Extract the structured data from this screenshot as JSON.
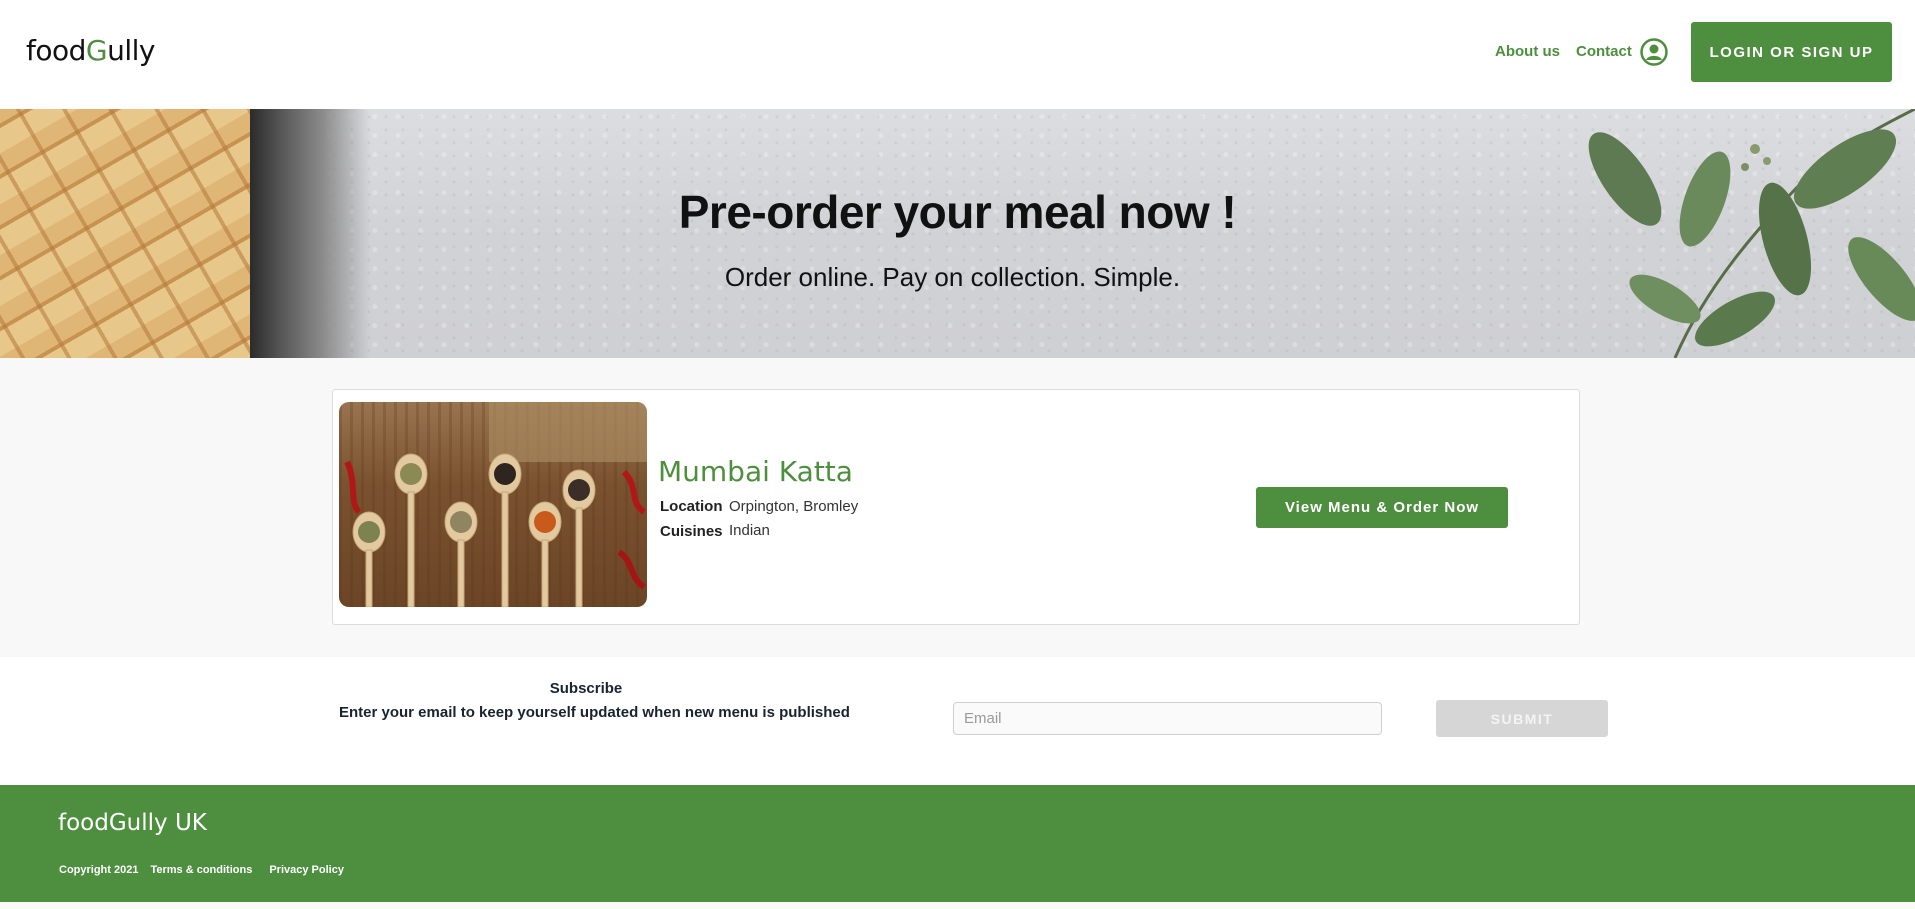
{
  "brand": {
    "logo_pre": "food",
    "logo_g": "G",
    "logo_post": "ully"
  },
  "nav": {
    "about": "About us",
    "contact": "Contact",
    "user_icon": "user-circle-icon",
    "login": "LOGIN OR SIGN UP"
  },
  "hero": {
    "title": "Pre-order your meal now !",
    "subtitle": "Order online. Pay on collection. Simple."
  },
  "restaurant": {
    "name": "Mumbai Katta",
    "location_label": "Location",
    "location_value": "Orpington, Bromley",
    "cuisines_label": "Cuisines",
    "cuisines_value": "Indian",
    "order_button": "View Menu & Order Now"
  },
  "subscribe": {
    "title": "Subscribe",
    "text": "Enter your email to keep yourself updated when new menu is published",
    "email_placeholder": "Email",
    "submit": "SUBMIT"
  },
  "footer": {
    "brand": "foodGully UK",
    "copyright": "Copyright 2021",
    "terms": "Terms & conditions",
    "privacy": "Privacy Policy"
  },
  "colors": {
    "accent": "#4e8f3f",
    "disabled": "#d6d6d6"
  }
}
